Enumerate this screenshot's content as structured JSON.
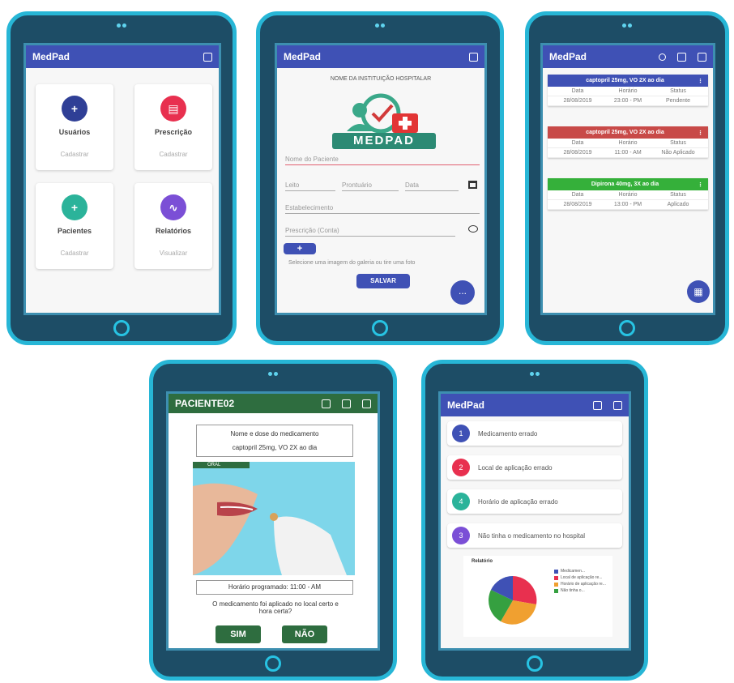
{
  "colors": {
    "frame": "#1d4d66",
    "frame_border": "#27b6d6",
    "primary": "#3f51b5",
    "patient_green": "#2e6d3f",
    "red_card": "#c84a48",
    "green_card": "#35b03a"
  },
  "app_name": "MedPad",
  "screen1": {
    "cards": [
      {
        "label": "Usuários",
        "action": "Cadastrar",
        "color": "#2f3f96",
        "icon": "add-user-icon"
      },
      {
        "label": "Prescrição",
        "action": "Cadastrar",
        "color": "#e8304f",
        "icon": "prescription-icon"
      },
      {
        "label": "Pacientes",
        "action": "Cadastrar",
        "color": "#2bb39a",
        "icon": "add-patient-icon"
      },
      {
        "label": "Relatórios",
        "action": "Visualizar",
        "color": "#7b4fd6",
        "icon": "chart-icon"
      }
    ]
  },
  "screen2": {
    "institution": "NOME DA INSTITUIÇÃO HOSPITALAR",
    "logo_text": "MEDPAD",
    "fields": {
      "name": "Nome do Paciente",
      "leito": "Leito",
      "prontuario": "Prontuário",
      "data": "Data",
      "estabelecimento": "Estabelecimento",
      "prescricao": "Prescrição (Conta)"
    },
    "add_label": "+",
    "hint": "Selecione uma imagem do galeria ou tire uma foto",
    "save_label": "SALVAR",
    "fab_label": "..."
  },
  "screen3": {
    "cards": [
      {
        "title": "captopril 25mg, VO 2X ao dia",
        "color": "#3f51b5",
        "cols": [
          "Data",
          "Horário",
          "Status"
        ],
        "values": [
          "28/08/2019",
          "23:00 - PM",
          "Pendente"
        ]
      },
      {
        "title": "captopril 25mg, VO 2X ao dia",
        "color": "#c84a48",
        "cols": [
          "Data",
          "Horário",
          "Status"
        ],
        "values": [
          "28/08/2019",
          "11:00 - AM",
          "Não Aplicado"
        ]
      },
      {
        "title": "Dipirona 40mg, 3X ao dia",
        "color": "#35b03a",
        "cols": [
          "Data",
          "Horário",
          "Status"
        ],
        "values": [
          "28/08/2019",
          "13:00 - PM",
          "Aplicado"
        ]
      }
    ]
  },
  "screen4": {
    "patient": "PACIENTE02",
    "med_title": "Nome e dose do medicamento",
    "med_value": "captopril 25mg, VO 2X ao dia",
    "route": "ORAL",
    "schedule": "Horário programado: 11:00 - AM",
    "question": "O medicamento foi aplicado no local certo e hora certa?",
    "yes": "SIM",
    "no": "NÃO"
  },
  "screen5": {
    "items": [
      {
        "num": "1",
        "text": "Medicamento errado",
        "color": "#3f51b5"
      },
      {
        "num": "2",
        "text": "Local de aplicação errado",
        "color": "#e8304f"
      },
      {
        "num": "4",
        "text": "Horário de aplicação errado",
        "color": "#2bb39a"
      },
      {
        "num": "3",
        "text": "Não tinha o medicamento no hospital",
        "color": "#7b4fd6"
      }
    ],
    "chart_label": "Relatório",
    "legend": [
      {
        "name": "Medicamen...",
        "color": "#3f51b5"
      },
      {
        "name": "Local de aplicação re...",
        "color": "#e8304f"
      },
      {
        "name": "Horário de aplicação re...",
        "color": "#f0a030"
      },
      {
        "name": "Não tinha o...",
        "color": "#35a040"
      }
    ]
  }
}
